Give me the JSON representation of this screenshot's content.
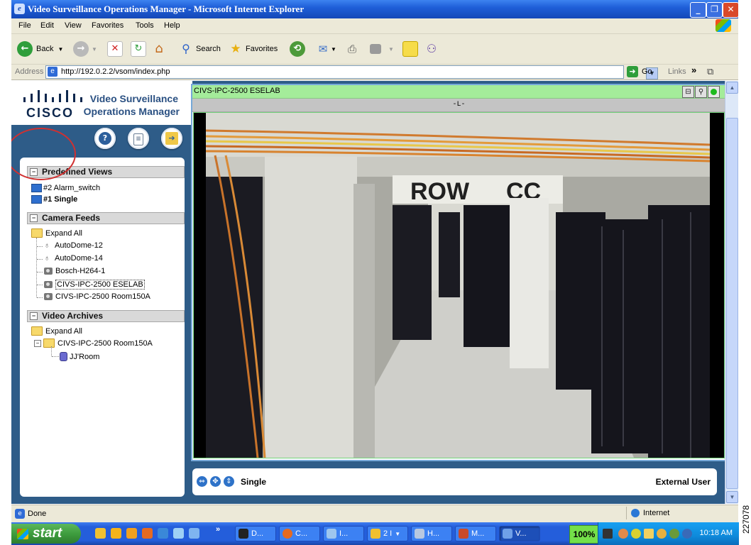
{
  "window": {
    "title": "Video Surveillance Operations Manager - Microsoft Internet Explorer",
    "controls": [
      "minimize",
      "maximize",
      "close"
    ]
  },
  "menu": [
    "File",
    "Edit",
    "View",
    "Favorites",
    "Tools",
    "Help"
  ],
  "toolbar": {
    "back_label": "Back",
    "search_label": "Search",
    "favorites_label": "Favorites"
  },
  "address": {
    "label": "Address",
    "url": "http://192.0.2.2/vsom/index.php",
    "go_label": "Go",
    "links_label": "Links"
  },
  "app": {
    "logo_text": "cisco",
    "title_line1": "Video Surveillance",
    "title_line2": "Operations Manager"
  },
  "sidebar": {
    "sections": [
      {
        "title": "Predefined Views",
        "items": [
          {
            "label": "#2 Alarm_switch",
            "bold": false
          },
          {
            "label": "#1 Single",
            "bold": true
          }
        ]
      },
      {
        "title": "Camera Feeds",
        "expand_all": "Expand All",
        "items": [
          {
            "label": "AutoDome-12",
            "icon": "dome-camera-icon"
          },
          {
            "label": "AutoDome-14",
            "icon": "dome-camera-icon"
          },
          {
            "label": "Bosch-H264-1",
            "icon": "camera-icon"
          },
          {
            "label": "CIVS-IPC-2500 ESELAB",
            "icon": "camera-icon",
            "selected": true
          },
          {
            "label": "CIVS-IPC-2500 Room150A",
            "icon": "camera-icon"
          }
        ]
      },
      {
        "title": "Video Archives",
        "expand_all": "Expand All",
        "items": [
          {
            "label": "CIVS-IPC-2500 Room150A",
            "icon": "archive-folder-icon"
          },
          {
            "label": "JJ'Room",
            "icon": "database-icon"
          }
        ]
      }
    ]
  },
  "video": {
    "camera_name": "CIVS-IPC-2500 ESELAB",
    "layout_indicator": "-L-"
  },
  "bottom": {
    "layout_name": "Single",
    "user": "External User"
  },
  "statusbar": {
    "status": "Done",
    "zone": "Internet"
  },
  "taskbar": {
    "start_label": "start",
    "tasks": [
      "D...",
      "C...",
      "I...",
      "2 I",
      "H...",
      "M...",
      "V..."
    ],
    "zoom": "100%",
    "clock": "10:18 AM"
  },
  "doc_number": "227078",
  "colors": {
    "title_bar": "#1f5fd8",
    "app_background": "#2e5c88",
    "header_green": "#a4ec9a",
    "annotation_red": "#d13030"
  }
}
